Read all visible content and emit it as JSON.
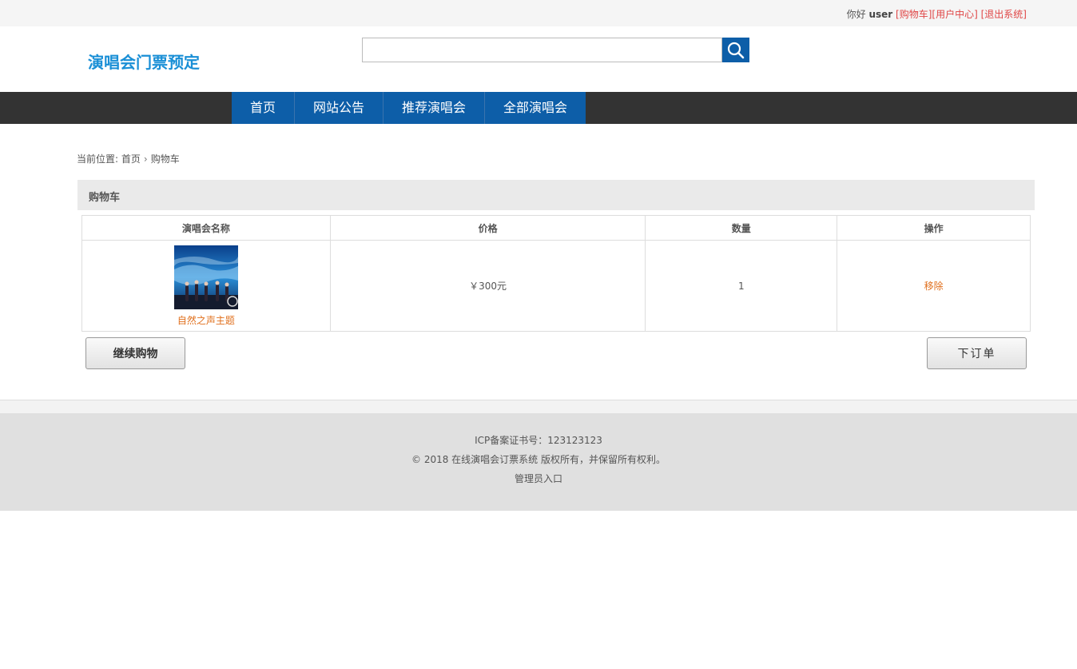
{
  "topbar": {
    "greeting": "你好",
    "username": "user",
    "links": [
      "[购物车]",
      "[用户中心]",
      "[退出系统]"
    ]
  },
  "header": {
    "logo": "演唱会门票预定",
    "search": {
      "value": "",
      "placeholder": ""
    }
  },
  "nav": [
    "首页",
    "网站公告",
    "推荐演唱会",
    "全部演唱会"
  ],
  "breadcrumb": {
    "prefix": "当前位置:",
    "home": "首页",
    "current": "购物车"
  },
  "panel": {
    "title": "购物车"
  },
  "table": {
    "headers": [
      "演唱会名称",
      "价格",
      "数量",
      "操作"
    ],
    "rows": [
      {
        "name": "自然之声主题",
        "price": "￥300元",
        "quantity": "1",
        "action": "移除",
        "image": "concert-stage-thumbnail"
      }
    ]
  },
  "buttons": {
    "continue": "继续购物",
    "order": "下订单"
  },
  "footer": {
    "icp": "ICP备案证书号：123123123",
    "copyright": "© 2018 在线演唱会订票系统 版权所有，并保留所有权利。",
    "admin": "管理员入口"
  },
  "colors": {
    "brand_blue": "#0d5ea8",
    "logo_blue": "#1a8fd6",
    "link_red": "#e04646",
    "accent_orange": "#e0701e",
    "nav_bg": "#333333"
  }
}
